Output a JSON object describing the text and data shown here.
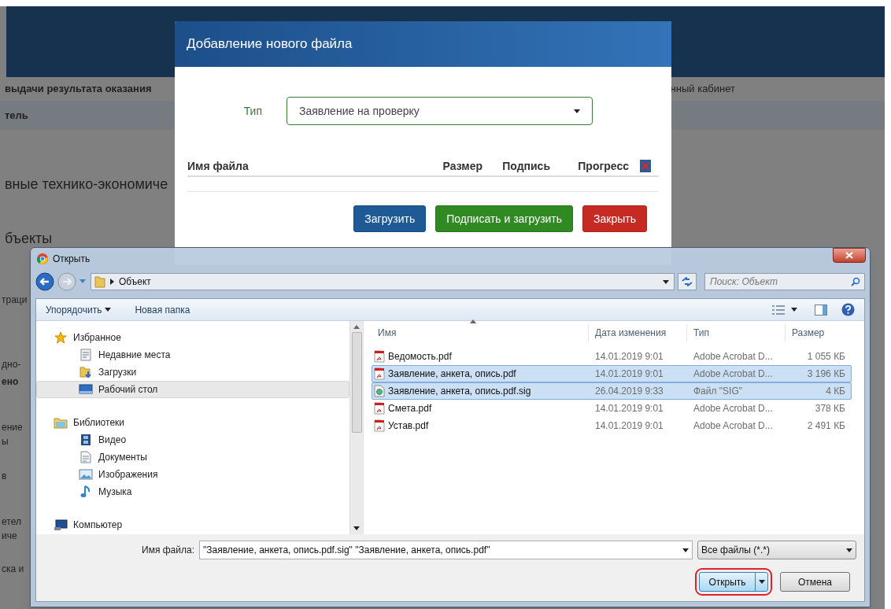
{
  "background_page": {
    "top_row_left": "выдачи результата оказания",
    "top_row_right": "нный кабинет",
    "band_text": "тель",
    "heading_1": "вные технико-экономиче",
    "heading_2": "бъекты",
    "fragments": [
      {
        "text": "траци",
        "bold": false
      },
      {
        "text": "дно-",
        "bold": false
      },
      {
        "text": "ено",
        "bold": true
      },
      {
        "text": "ение",
        "bold": false
      },
      {
        "text": "ы",
        "bold": false
      },
      {
        "text": "в",
        "bold": false
      },
      {
        "text": "етел",
        "bold": false
      },
      {
        "text": "иче",
        "bold": false
      },
      {
        "text": "ска и",
        "bold": false
      }
    ]
  },
  "modal": {
    "title": "Добавление нового файла",
    "type_label": "Тип",
    "type_value": "Заявление на проверку",
    "columns": [
      "Имя файла",
      "Размер",
      "Подпись",
      "Прогресс"
    ],
    "buttons": [
      {
        "label": "Загрузить",
        "kind": "primary"
      },
      {
        "label": "Подписать и загрузить",
        "kind": "success"
      },
      {
        "label": "Закрыть",
        "kind": "danger"
      }
    ]
  },
  "open_dialog": {
    "title": "Открыть",
    "breadcrumb": "Объект",
    "search_placeholder": "Поиск: Объект",
    "toolbar": [
      "Упорядочить",
      "Новая папка"
    ],
    "nav": [
      {
        "label": "Избранное",
        "kind": "star",
        "selected": false,
        "children": [
          {
            "label": "Недавние места",
            "kind": "recent",
            "selected": false
          },
          {
            "label": "Загрузки",
            "kind": "downloads",
            "selected": false
          },
          {
            "label": "Рабочий стол",
            "kind": "desktop",
            "selected": true
          }
        ]
      },
      {
        "label": "Библиотеки",
        "kind": "library",
        "selected": false,
        "children": [
          {
            "label": "Видео",
            "kind": "video",
            "selected": false
          },
          {
            "label": "Документы",
            "kind": "documents",
            "selected": false
          },
          {
            "label": "Изображения",
            "kind": "images",
            "selected": false
          },
          {
            "label": "Музыка",
            "kind": "music",
            "selected": false
          }
        ]
      },
      {
        "label": "Компьютер",
        "kind": "computer",
        "selected": false
      }
    ],
    "columns": [
      "Имя",
      "Дата изменения",
      "Тип",
      "Размер"
    ],
    "files": [
      {
        "name": "Ведомость.pdf",
        "date": "14.01.2019 9:01",
        "type": "Adobe Acrobat D...",
        "size": "1 055 КБ",
        "kind": "pdf",
        "selected": false
      },
      {
        "name": "Заявление, анкета, опись.pdf",
        "date": "14.01.2019 9:01",
        "type": "Adobe Acrobat D...",
        "size": "3 196 КБ",
        "kind": "pdf",
        "selected": true
      },
      {
        "name": "Заявление, анкета, опись.pdf.sig",
        "date": "26.04.2019 9:33",
        "type": "Файл \"SIG\"",
        "size": "4 КБ",
        "kind": "sig",
        "selected": true
      },
      {
        "name": "Смета.pdf",
        "date": "14.01.2019 9:01",
        "type": "Adobe Acrobat D...",
        "size": "378 КБ",
        "kind": "pdf",
        "selected": false
      },
      {
        "name": "Устав.pdf",
        "date": "14.01.2019 9:01",
        "type": "Adobe Acrobat D...",
        "size": "2 491 КБ",
        "kind": "pdf",
        "selected": false
      }
    ],
    "filename_label": "Имя файла:",
    "filename_value": "\"Заявление, анкета, опись.pdf.sig\" \"Заявление, анкета, опись.pdf\"",
    "filetype": "Все файлы (*.*)",
    "open_button": "Открыть",
    "cancel_button": "Отмена"
  }
}
